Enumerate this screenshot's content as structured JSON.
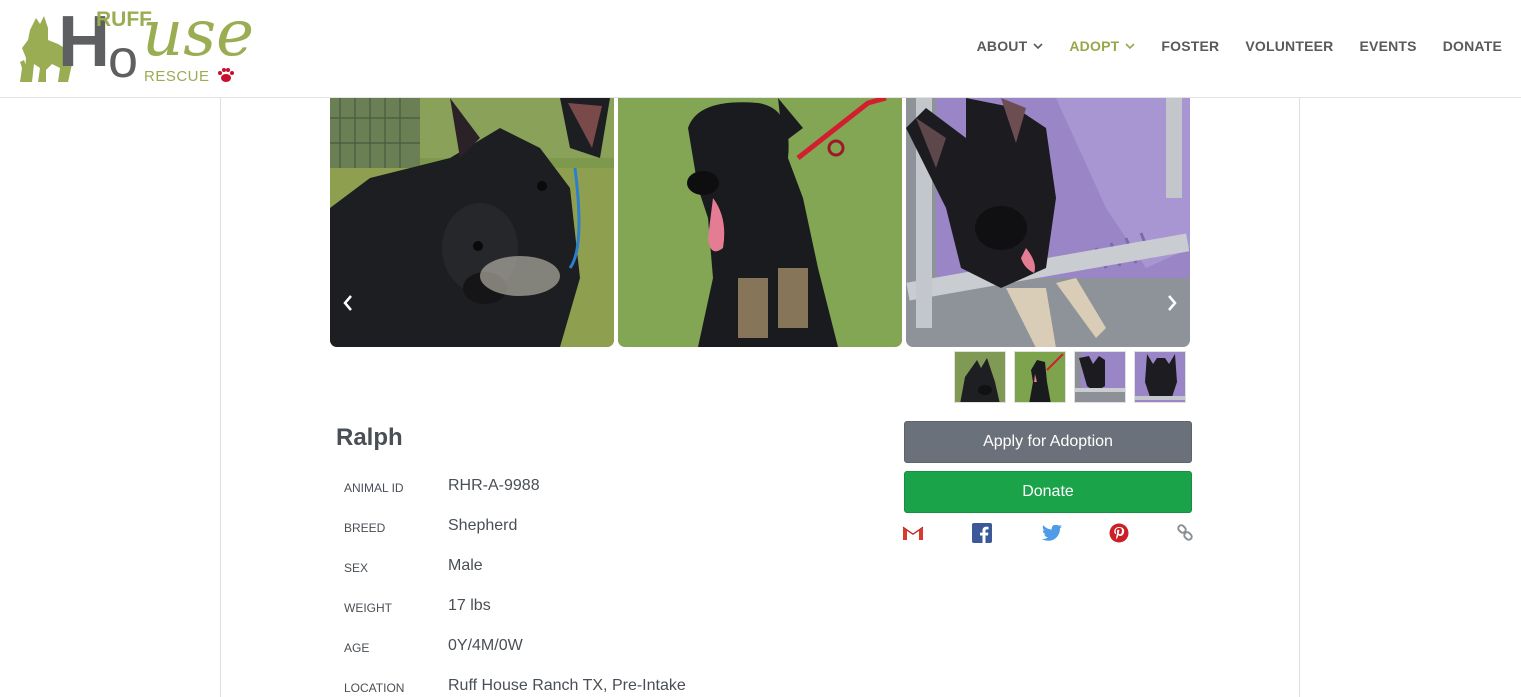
{
  "brand": {
    "logo_ruff": "RUFF",
    "logo_house_h": "H",
    "logo_house_o": "o",
    "logo_house_use": "use",
    "logo_rescue": "RESCUE",
    "color_green": "#9aad52",
    "color_gray": "#5d5f60",
    "color_paw": "#c8102e"
  },
  "nav": {
    "items": [
      {
        "label": "ABOUT",
        "dropdown": true,
        "active": false
      },
      {
        "label": "ADOPT",
        "dropdown": true,
        "active": true
      },
      {
        "label": "FOSTER",
        "dropdown": false,
        "active": false
      },
      {
        "label": "VOLUNTEER",
        "dropdown": false,
        "active": false
      },
      {
        "label": "EVENTS",
        "dropdown": false,
        "active": false
      },
      {
        "label": "DONATE",
        "dropdown": false,
        "active": false
      }
    ],
    "active_color": "#95a84a"
  },
  "gallery": {
    "prev_icon": "chevron-left-icon",
    "next_icon": "chevron-right-icon",
    "photo_count": 3,
    "thumbnail_count": 4
  },
  "pet": {
    "name": "Ralph",
    "details": [
      {
        "label": "ANIMAL ID",
        "value": "RHR-A-9988"
      },
      {
        "label": "BREED",
        "value": "Shepherd"
      },
      {
        "label": "SEX",
        "value": "Male"
      },
      {
        "label": "WEIGHT",
        "value": "17 lbs"
      },
      {
        "label": "AGE",
        "value": "0Y/4M/0W"
      },
      {
        "label": "LOCATION",
        "value": "Ruff House Ranch TX, Pre-Intake"
      }
    ]
  },
  "actions": {
    "apply_label": "Apply for Adoption",
    "donate_label": "Donate",
    "apply_color": "#6b717a",
    "donate_color": "#1ba34a"
  },
  "share": {
    "icons": [
      "gmail-icon",
      "facebook-icon",
      "twitter-icon",
      "pinterest-icon",
      "link-icon"
    ]
  }
}
